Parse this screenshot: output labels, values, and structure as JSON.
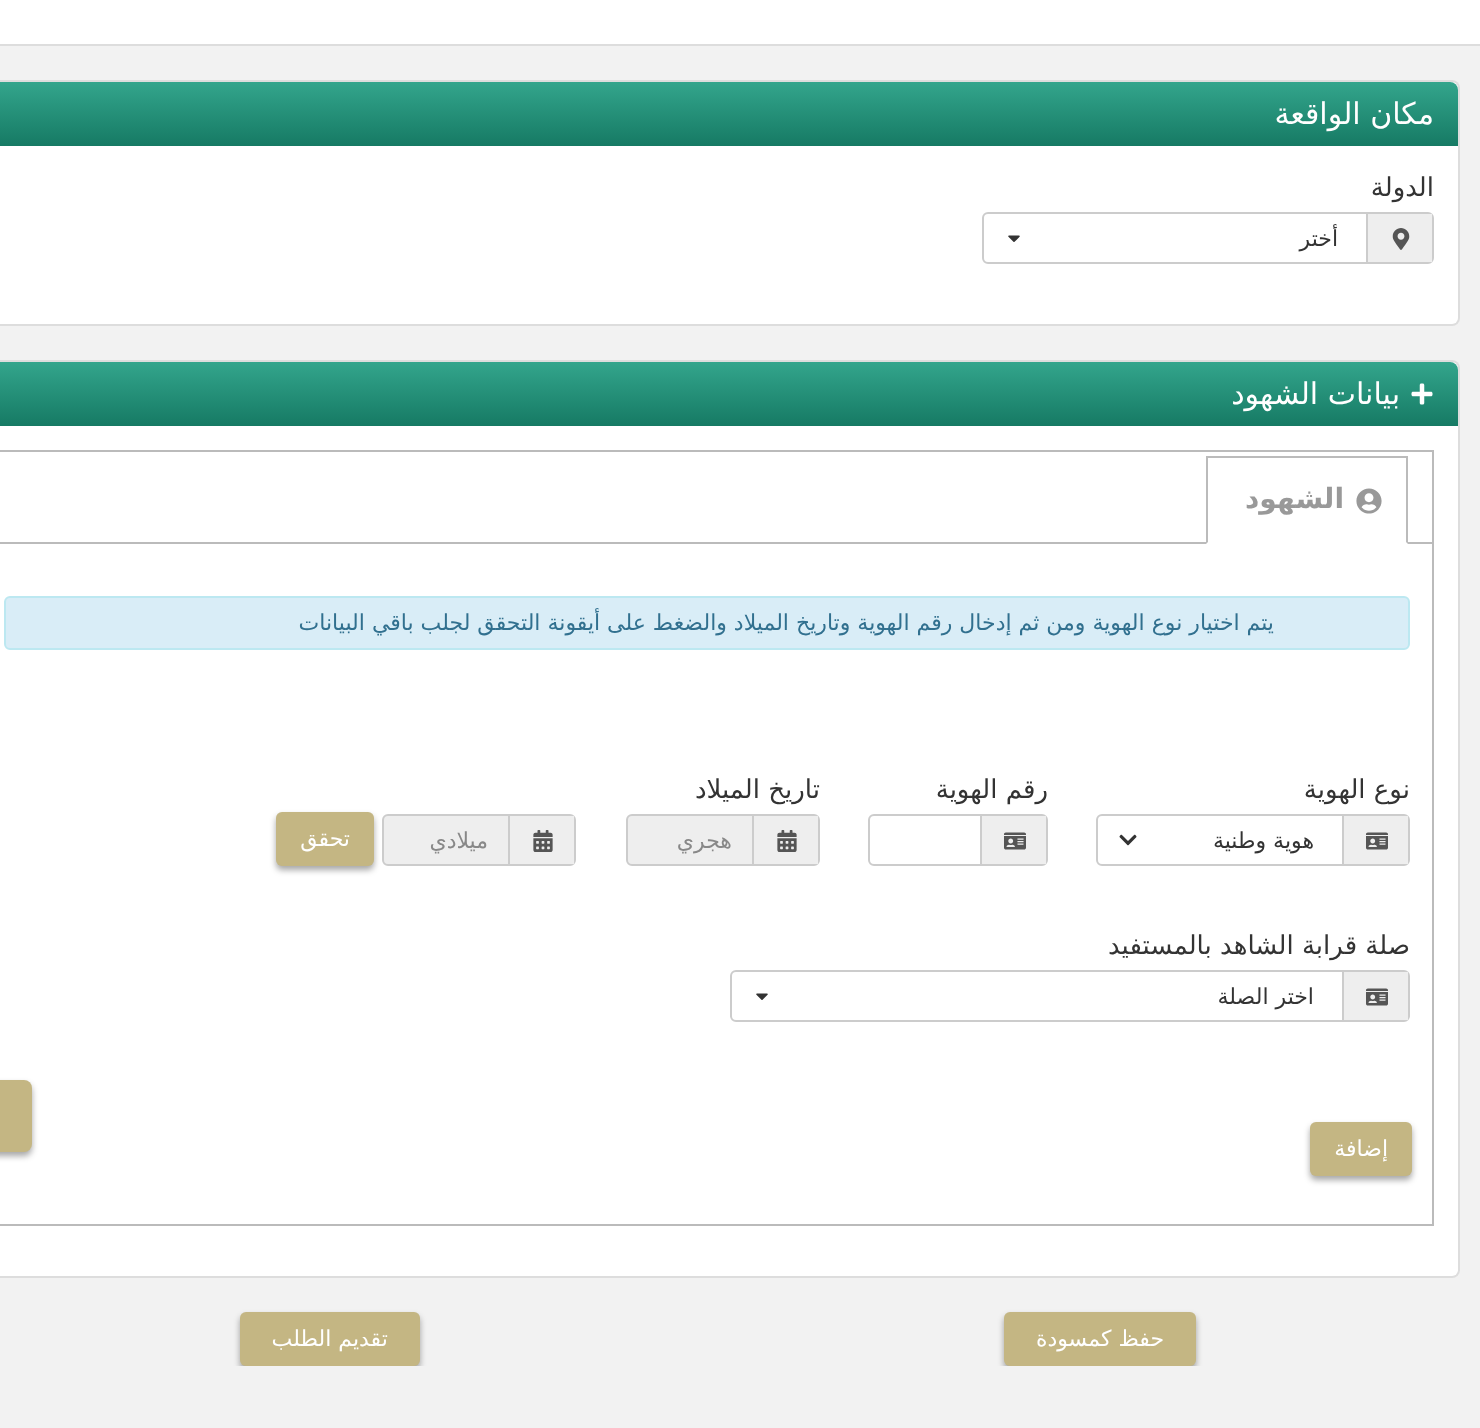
{
  "incident_place": {
    "title": "مكان الواقعة",
    "country": {
      "label": "الدولة",
      "value": "أختر"
    }
  },
  "witnesses": {
    "title": "بيانات الشهود",
    "tabs": [
      {
        "label": "الشهود",
        "selected": true
      }
    ],
    "notice": "يتم اختيار نوع الهوية ومن ثم إدخال رقم الهوية وتاريخ الميلاد والضغط على أيقونة التحقق لجلب باقي البيانات",
    "id_type": {
      "label": "نوع الهوية",
      "value": "هوية وطنية"
    },
    "id_number": {
      "label": "رقم الهوية",
      "disabled": false
    },
    "birth_date": {
      "label": "تاريخ الميلاد",
      "hijri": {
        "placeholder": "هجري",
        "disabled": true
      },
      "gregorian": {
        "placeholder": "ميلادي",
        "disabled": true
      }
    },
    "verify_button": "تحقق",
    "relation": {
      "label": "صلة قرابة الشاهد بالمستفيد",
      "value": "اختر الصلة"
    },
    "add_button": "إضافة"
  },
  "actions": [
    "حفظ كمسودة",
    "تقديم الطلب"
  ]
}
